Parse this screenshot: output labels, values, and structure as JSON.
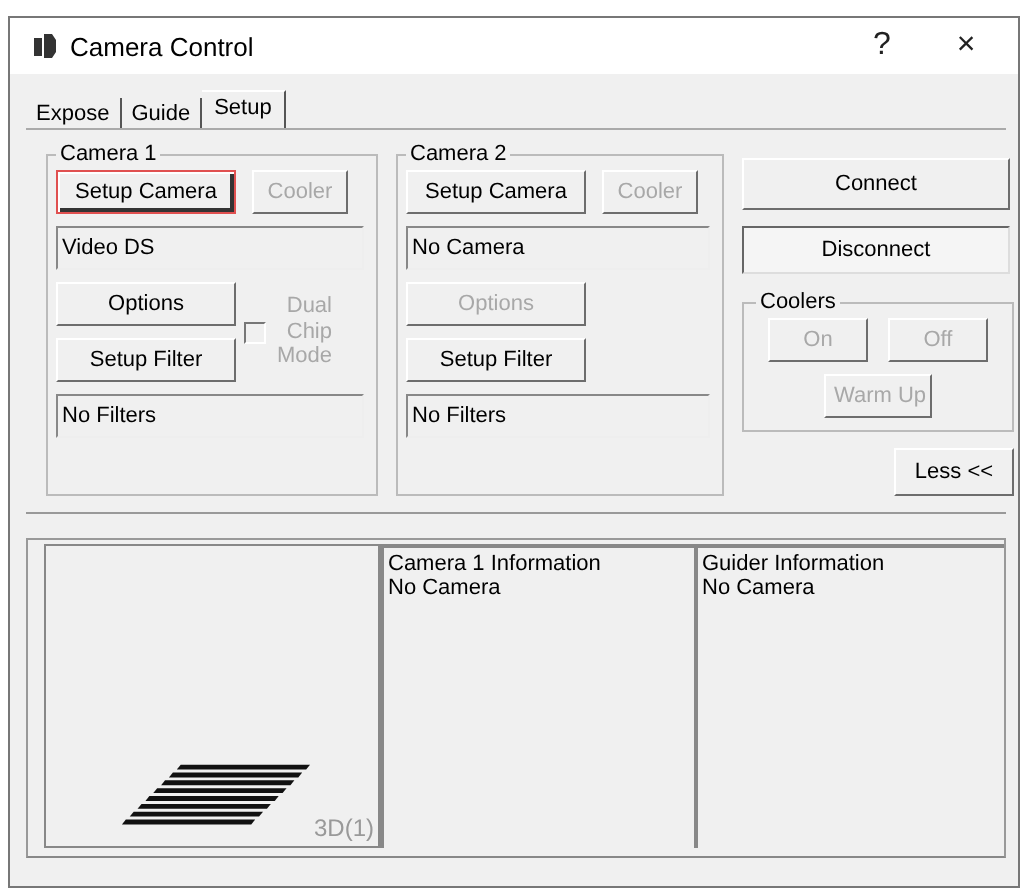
{
  "window": {
    "title": "Camera Control",
    "help": "?",
    "close": "×"
  },
  "tabs": [
    {
      "label": "Expose",
      "selected": false
    },
    {
      "label": "Guide",
      "selected": false
    },
    {
      "label": "Setup",
      "selected": true
    }
  ],
  "cameras": [
    {
      "title": "Camera 1",
      "setup_camera": {
        "label": "Setup Camera",
        "disabled": false,
        "focused": true
      },
      "cooler": {
        "label": "Cooler",
        "disabled": true
      },
      "camera_field": "Video DS",
      "options": {
        "label": "Options",
        "disabled": false
      },
      "dual_chip": {
        "label": "Dual Chip Mode",
        "checked": false,
        "disabled": true
      },
      "setup_filter": {
        "label": "Setup Filter",
        "disabled": false
      },
      "filter_field": "No Filters"
    },
    {
      "title": "Camera 2",
      "setup_camera": {
        "label": "Setup Camera",
        "disabled": false,
        "focused": false
      },
      "cooler": {
        "label": "Cooler",
        "disabled": true
      },
      "camera_field": "No Camera",
      "options": {
        "label": "Options",
        "disabled": true
      },
      "setup_filter": {
        "label": "Setup Filter",
        "disabled": false
      },
      "filter_field": "No Filters"
    }
  ],
  "connect": {
    "label": "Connect"
  },
  "disconnect": {
    "label": "Disconnect"
  },
  "coolers": {
    "title": "Coolers",
    "buttons": [
      {
        "label": "On",
        "disabled": true
      },
      {
        "label": "Off",
        "disabled": true
      },
      {
        "label": "Warm Up",
        "disabled": true
      }
    ]
  },
  "less": {
    "label": "Less <<"
  },
  "preview": {
    "label": "3D(1)"
  },
  "info_panels": [
    {
      "title": "Camera 1 Information",
      "status": "No Camera"
    },
    {
      "title": "Guider Information",
      "status": "No Camera"
    }
  ]
}
